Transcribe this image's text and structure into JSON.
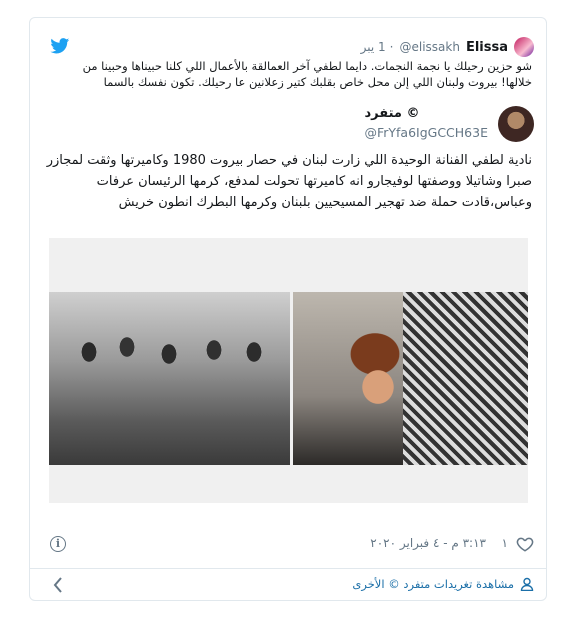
{
  "reply": {
    "name": "Elissa",
    "handle": "@elissakh",
    "separator": "·",
    "time": "1 يبر",
    "text": "شو حزين رحيلك يا نجمة النجمات. دايما لطفي آخر العمالقة بالأعمال اللي كلنا حبيناها وحبينا من خلالها! بيروت ولبنان اللي إلن محل خاص بقلبك كتير زعلانين عا رحيلك. تكون نفسك بالسما"
  },
  "author": {
    "name": "© متفرد",
    "handle": "@FrYfa6IgGCCH63E"
  },
  "tweet": {
    "text": "نادية لطفي الفنانة الوحيدة اللي زارت لبنان في حصار بيروت 1980 وكاميرتها وثقت لمجازر صبرا وشاتيلا ووصفتها لوفيجارو انه كاميرتها تحولت لمدفع، كرمها الرئيسان عرفات وعباس،قادت حملة ضد تهجير المسيحيين بلبنان وكرمها البطرك انطون خريش"
  },
  "actions": {
    "like_count": "١",
    "timestamp": "٣:١٣ م - ٤ فبراير ٢٠٢٠",
    "info_icon": "i"
  },
  "footer": {
    "link_label": "مشاهدة تغريدات متفرد © الأخرى"
  },
  "colors": {
    "brand": "#1da1f2",
    "muted": "#657786",
    "link": "#1b6fa8",
    "border": "#e1e8ed"
  },
  "icons": {
    "brand": "twitter-bird-icon",
    "like": "heart-icon",
    "info": "info-icon",
    "back": "chevron-left-icon",
    "profile": "person-icon"
  }
}
